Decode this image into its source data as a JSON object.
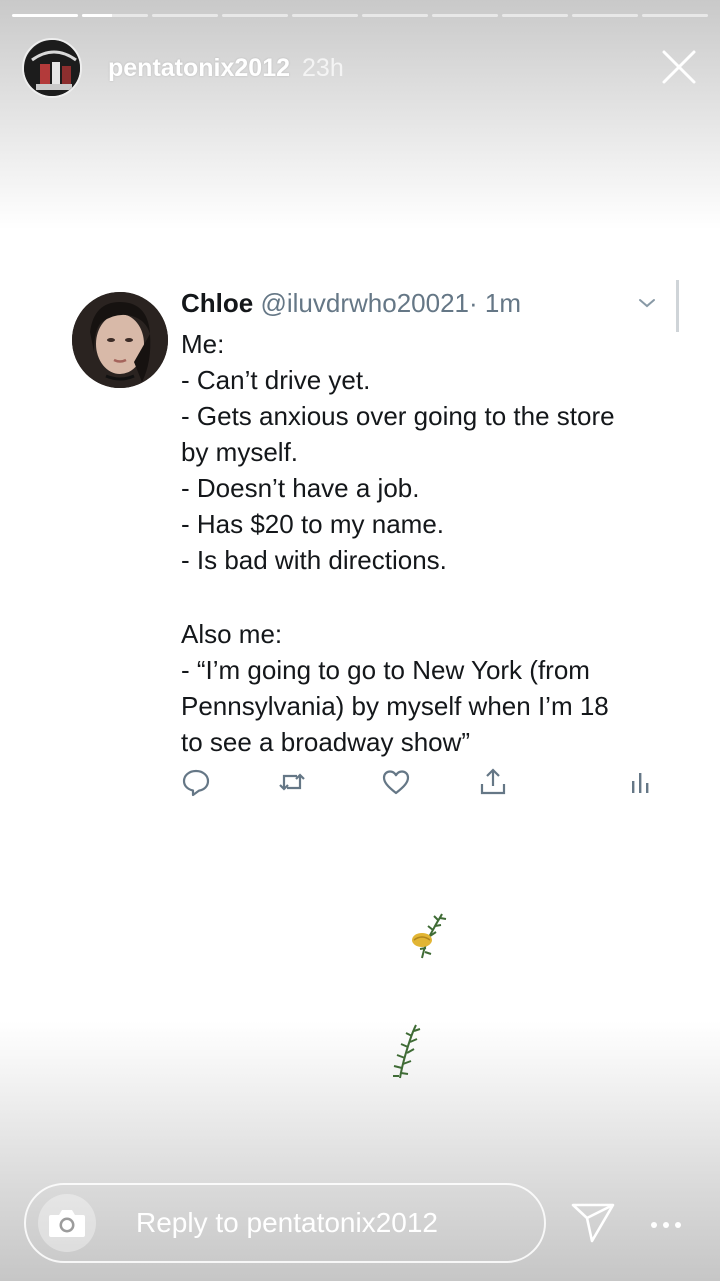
{
  "story": {
    "username": "pentatonix2012",
    "time_ago": "23h",
    "segments_total": 10,
    "current_segment": 2,
    "current_segment_progress": 0.45
  },
  "tweet": {
    "name": "Chloe",
    "handle": "@iluvdrwho20021",
    "time": "· 1m",
    "lines": [
      "Me:",
      "- Can’t drive yet.",
      "- Gets anxious over going to the store",
      "by myself.",
      "- Doesn’t have a job.",
      "- Has $20 to my name.",
      "- Is bad with directions.",
      "",
      "Also me:",
      "- “I’m going to go to New York (from",
      "Pennsylvania) by myself when I’m 18",
      "to see a broadway show”"
    ]
  },
  "reply": {
    "placeholder": "Reply to pentatonix2012"
  },
  "icons": {
    "close": "close-icon",
    "camera": "camera-icon",
    "send": "send-icon",
    "more": "more-icon",
    "reply": "reply-icon",
    "retweet": "retweet-icon",
    "like": "heart-icon",
    "share": "share-icon",
    "analytics": "analytics-icon"
  },
  "colors": {
    "handle": "#657786",
    "text": "#14171a",
    "icon": "#657786"
  }
}
